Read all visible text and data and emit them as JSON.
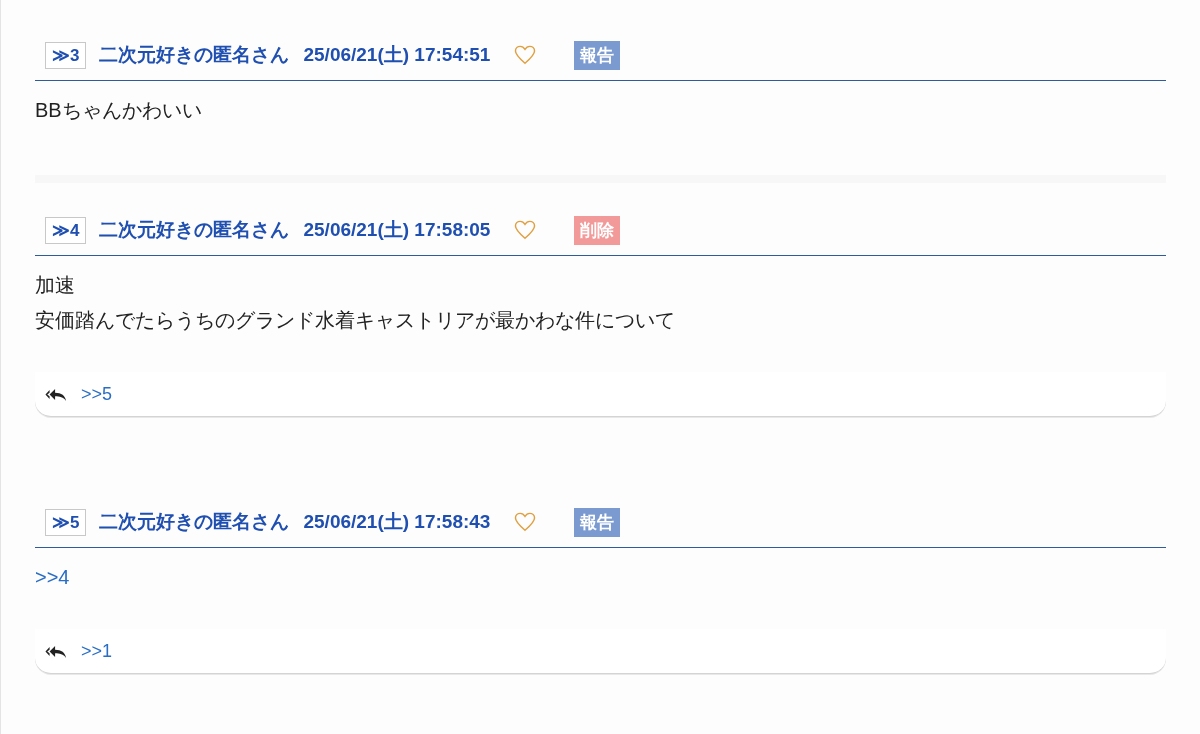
{
  "posts": [
    {
      "number": "≫3",
      "name": "二次元好きの匿名さん",
      "date": "25/06/21(土) 17:54:51",
      "action": {
        "kind": "report",
        "label": "報告"
      },
      "body": [
        {
          "kind": "text",
          "text": "BBちゃんかわいい"
        }
      ]
    },
    {
      "number": "≫4",
      "name": "二次元好きの匿名さん",
      "date": "25/06/21(土) 17:58:05",
      "action": {
        "kind": "delete",
        "label": "削除"
      },
      "body": [
        {
          "kind": "text",
          "text": "加速"
        },
        {
          "kind": "text",
          "text": "安価踏んでたらうちのグランド水着キャストリアが最かわな件について"
        }
      ],
      "replies": [
        ">>5"
      ]
    },
    {
      "number": "≫5",
      "name": "二次元好きの匿名さん",
      "date": "25/06/21(土) 17:58:43",
      "action": {
        "kind": "report",
        "label": "報告"
      },
      "body": [
        {
          "kind": "link",
          "text": ">>4"
        }
      ],
      "replies": [
        ">>1"
      ]
    }
  ]
}
